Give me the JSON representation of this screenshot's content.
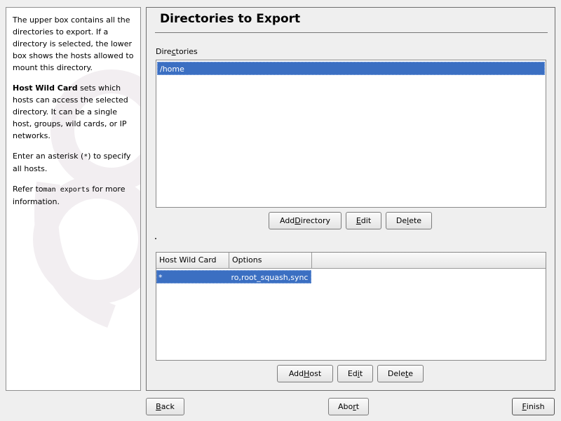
{
  "help": {
    "p1": "The upper box contains all the directories to export. If a directory is selected, the lower box shows the hosts allowed to mount this directory.",
    "p2_bold": "Host Wild Card",
    "p2_rest": " sets which hosts can access the selected directory. It can be a single host, groups, wild cards, or IP networks.",
    "p3_pre": "Enter an asterisk (",
    "p3_code": "*",
    "p3_post": ") to specify all hosts.",
    "p4_pre": "Refer to",
    "p4_code": "man exports",
    "p4_post": " for more information."
  },
  "main": {
    "title": "Directories to Export",
    "directories_label": {
      "pre": "Dire",
      "u": "c",
      "post": "tories"
    },
    "directories": [
      "/home"
    ],
    "dir_buttons": {
      "add": {
        "pre": "Add ",
        "u": "D",
        "post": "irectory"
      },
      "edit": {
        "pre": "",
        "u": "E",
        "post": "dit"
      },
      "delete": {
        "pre": "De",
        "u": "l",
        "post": "ete"
      }
    },
    "host_table": {
      "columns": [
        "Host Wild Card",
        "Options"
      ],
      "rows": [
        {
          "host": "*",
          "options": "ro,root_squash,sync"
        }
      ]
    },
    "host_buttons": {
      "add": {
        "pre": "Add ",
        "u": "H",
        "post": "ost"
      },
      "edit": {
        "pre": "Ed",
        "u": "i",
        "post": "t"
      },
      "delete": {
        "pre": "Dele",
        "u": "t",
        "post": "e"
      }
    }
  },
  "footer": {
    "back": {
      "pre": "",
      "u": "B",
      "post": "ack"
    },
    "abort": {
      "pre": "Abo",
      "u": "r",
      "post": "t"
    },
    "finish": {
      "pre": "",
      "u": "F",
      "post": "inish"
    }
  },
  "colors": {
    "selection": "#3b6fc2",
    "window_bg": "#efefef"
  }
}
